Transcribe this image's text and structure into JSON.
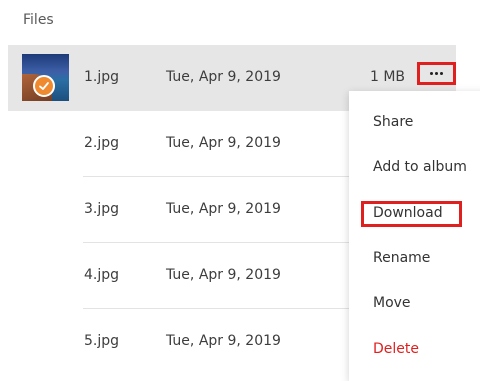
{
  "section": {
    "title": "Files"
  },
  "files": [
    {
      "name": "1.jpg",
      "date": "Tue, Apr 9, 2019",
      "size": "1 MB"
    },
    {
      "name": "2.jpg",
      "date": "Tue, Apr 9, 2019"
    },
    {
      "name": "3.jpg",
      "date": "Tue, Apr 9, 2019"
    },
    {
      "name": "4.jpg",
      "date": "Tue, Apr 9, 2019"
    },
    {
      "name": "5.jpg",
      "date": "Tue, Apr 9, 2019"
    }
  ],
  "more_button": {
    "icon": "more-horizontal-icon"
  },
  "menu": {
    "items": [
      {
        "label": "Share"
      },
      {
        "label": "Add to album"
      },
      {
        "label": "Download"
      },
      {
        "label": "Rename"
      },
      {
        "label": "Move"
      },
      {
        "label": "Delete"
      }
    ]
  },
  "colors": {
    "highlight": "#e0201f",
    "selected_row": "#e6e6e6",
    "check": "#f08a2e",
    "danger": "#e0201f"
  }
}
